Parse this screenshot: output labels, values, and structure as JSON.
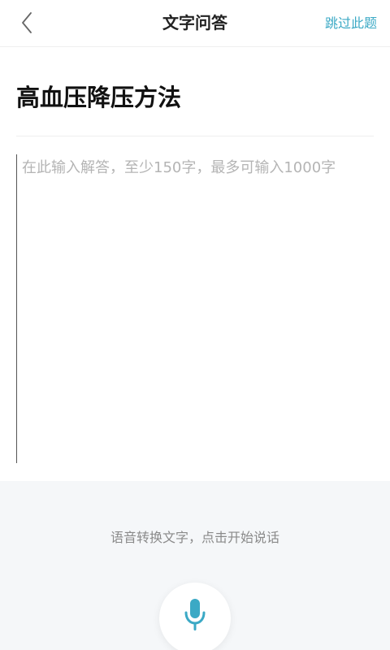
{
  "header": {
    "title": "文字问答",
    "skip_label": "跳过此题",
    "back_icon": "chevron-left-icon"
  },
  "question": {
    "title": "高血压降压方法"
  },
  "answer": {
    "placeholder": "在此输入解答，至少150字，最多可输入1000字",
    "value": ""
  },
  "voice": {
    "hint": "语音转换文字，点击开始说话",
    "mic_icon": "microphone-icon"
  },
  "colors": {
    "accent": "#3ba9c5",
    "panel_background": "#f5f7f9",
    "placeholder": "#b4b4b4"
  }
}
